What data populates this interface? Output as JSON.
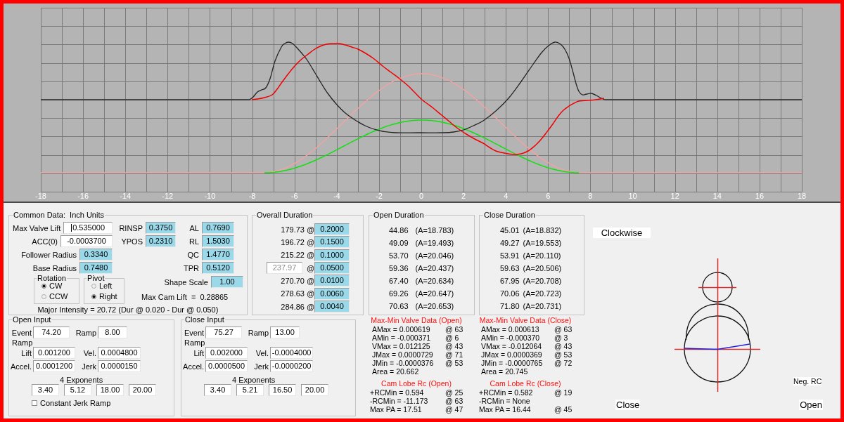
{
  "chart": {
    "x_tick_labels": [
      "-18",
      "-16",
      "-14",
      "-12",
      "-10",
      "-8",
      "-6",
      "-4",
      "-2",
      "0",
      "2",
      "4",
      "6",
      "8",
      "10",
      "12",
      "14",
      "16",
      "18"
    ]
  },
  "common_data": {
    "title": "Common Data:  Inch Units",
    "left_fields": [
      {
        "label": "Max Valve Lift",
        "value": "0.535000",
        "kind": "entry",
        "focused": true
      },
      {
        "label": "ACC(0)",
        "value": "-0.0003700",
        "kind": "entry",
        "focused": false
      },
      {
        "label": "Follower Radius",
        "value": "0.3340",
        "kind": "readout",
        "focused": false
      },
      {
        "label": "Base Radius",
        "value": "0.7480",
        "kind": "readout",
        "focused": false
      }
    ],
    "middle_fields": [
      {
        "label": "RINSP",
        "value": "0.3750",
        "kind": "readout"
      },
      {
        "label": "YPOS",
        "value": "0.2310",
        "kind": "readout"
      }
    ],
    "right_fields": [
      {
        "label": "AL",
        "value": "0.7690",
        "kind": "readout"
      },
      {
        "label": "RL",
        "value": "1.5030",
        "kind": "readout"
      },
      {
        "label": "QC",
        "value": "1.4770",
        "kind": "readout"
      },
      {
        "label": "TPR",
        "value": "0.5120",
        "kind": "readout"
      }
    ],
    "shape_scale": {
      "label": "Shape Scale",
      "value": "1.00",
      "kind": "readout"
    },
    "rotation": {
      "title": "Rotation",
      "options": [
        {
          "label": "CW",
          "selected": true
        },
        {
          "label": "CCW",
          "selected": false
        }
      ]
    },
    "pivot": {
      "title": "Pivot",
      "options": [
        {
          "label": "Left",
          "selected": false
        },
        {
          "label": "Right",
          "selected": true
        }
      ]
    },
    "max_cam_lift": "Max Cam Lift  =  0.28865",
    "major_intensity": "Major Intensity = 20.72 (Dur @ 0.020 - Dur @ 0.050)"
  },
  "overall_duration": {
    "title": "Overall Duration",
    "rows": [
      {
        "duration": "179.73",
        "separator": "@",
        "lift": "0.2000",
        "kind": "text"
      },
      {
        "duration": "196.72",
        "separator": "@",
        "lift": "0.1500",
        "kind": "text"
      },
      {
        "duration": "215.22",
        "separator": "@",
        "lift": "0.1000",
        "kind": "text"
      },
      {
        "duration": "237.97",
        "separator": "@",
        "lift": "0.0500",
        "kind": "field"
      },
      {
        "duration": "270.70",
        "separator": "@",
        "lift": "0.0100",
        "kind": "text"
      },
      {
        "duration": "278.63",
        "separator": "@",
        "lift": "0.0060",
        "kind": "text"
      },
      {
        "duration": "284.86",
        "separator": "@",
        "lift": "0.0040",
        "kind": "text"
      }
    ]
  },
  "open_duration": {
    "title": "Open Duration",
    "rows": [
      {
        "duration": "44.86",
        "area": "(A=18.783)"
      },
      {
        "duration": "49.09",
        "area": "(A=19.493)"
      },
      {
        "duration": "53.70",
        "area": "(A=20.046)"
      },
      {
        "duration": "59.36",
        "area": "(A=20.437)"
      },
      {
        "duration": "67.40",
        "area": "(A=20.634)"
      },
      {
        "duration": "69.26",
        "area": "(A=20.647)"
      },
      {
        "duration": "70.63",
        "area": "(A=20.653)"
      }
    ]
  },
  "close_duration": {
    "title": "Close Duration",
    "rows": [
      {
        "duration": "45.01",
        "area": "(A=18.832)"
      },
      {
        "duration": "49.27",
        "area": "(A=19.553)"
      },
      {
        "duration": "53.91",
        "area": "(A=20.110)"
      },
      {
        "duration": "59.63",
        "area": "(A=20.506)"
      },
      {
        "duration": "67.95",
        "area": "(A=20.708)"
      },
      {
        "duration": "70.06",
        "area": "(A=20.723)"
      },
      {
        "duration": "71.80",
        "area": "(A=20.731)"
      }
    ]
  },
  "open_input": {
    "title": "Open Input",
    "event": {
      "label": "Event",
      "value": "74.20"
    },
    "ramp": {
      "label": "Ramp",
      "value": "8.00"
    },
    "ramp_heading": "Ramp",
    "lift": {
      "label": "Lift",
      "value": "0.001200"
    },
    "vel": {
      "label": "Vel.",
      "value": "0.0004800"
    },
    "accel": {
      "label": "Accel.",
      "value": "0.0001200"
    },
    "jerk": {
      "label": "Jerk",
      "value": "0.0000150"
    },
    "exponents_title": "4 Exponents",
    "exponents": [
      "3.40",
      "5.12",
      "18.00",
      "20.00"
    ],
    "constant_jerk_ramp": {
      "label": "Constant Jerk Ramp",
      "checked": false
    }
  },
  "close_input": {
    "title": "Close Input",
    "event": {
      "label": "Event",
      "value": "75.27"
    },
    "ramp": {
      "label": "Ramp",
      "value": "13.00"
    },
    "ramp_heading": "Ramp",
    "lift": {
      "label": "Lift",
      "value": "0.002000"
    },
    "vel": {
      "label": "Vel.",
      "value": "-0.0004000"
    },
    "accel": {
      "label": "Accel.",
      "value": "0.0000500"
    },
    "jerk": {
      "label": "Jerk",
      "value": "-0.0000200"
    },
    "exponents_title": "4 Exponents",
    "exponents": [
      "3.40",
      "5.21",
      "16.50",
      "20.00"
    ]
  },
  "max_min_columns": [
    {
      "valve": {
        "title": "Max-Min Valve Data (Open)",
        "rows": [
          {
            "text": "AMax = 0.000619",
            "at": "@ 63"
          },
          {
            "text": "AMin = -0.000371",
            "at": "@ 6"
          },
          {
            "text": "VMax = 0.012125",
            "at": "@ 43"
          },
          {
            "text": "JMax = 0.0000729",
            "at": "@ 71"
          },
          {
            "text": "JMin = -0.0000376",
            "at": "@ 53"
          },
          {
            "text": "Area = 20.662"
          }
        ]
      },
      "cam_lobe": {
        "title": "Cam Lobe Rc (Open)",
        "rows": [
          {
            "text": "+RCMin = 0.594",
            "at": "@ 25"
          },
          {
            "text": "-RCMin = -11.173",
            "at": "@ 63"
          },
          {
            "text": "Max PA = 17.51",
            "at": "@ 47"
          }
        ]
      }
    },
    {
      "valve": {
        "title": "Max-Min Valve Data (Close)",
        "rows": [
          {
            "text": "AMax = 0.000613",
            "at": "@ 63"
          },
          {
            "text": "AMin = -0.000370",
            "at": "@ 3"
          },
          {
            "text": "VMax = -0.012064",
            "at": "@ 43"
          },
          {
            "text": "JMax = 0.0000369",
            "at": "@ 53"
          },
          {
            "text": "JMin = -0.0000765",
            "at": "@ 72"
          },
          {
            "text": "Area = 20.745"
          }
        ]
      },
      "cam_lobe": {
        "title": "Cam Lobe Rc (Close)",
        "rows": [
          {
            "text": "+RCMin = 0.582",
            "at": "@ 19"
          },
          {
            "text": "-RCMin = None"
          },
          {
            "text": "Max PA = 16.44",
            "at": "@ 45"
          }
        ]
      }
    }
  ],
  "diagram": {
    "direction": "Clockwise",
    "note": "Neg. RC",
    "left_label": "Close",
    "right_label": "Open"
  }
}
